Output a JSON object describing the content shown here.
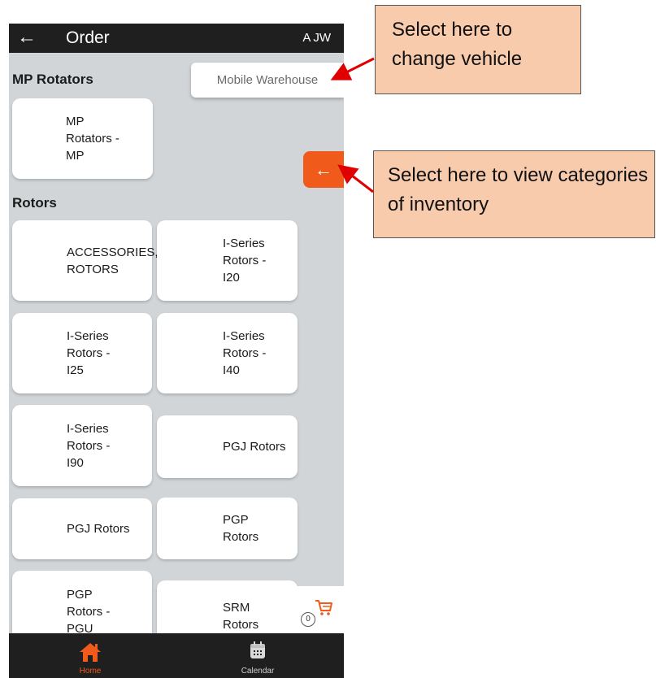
{
  "app": {
    "title": "Order",
    "back_icon": "back-arrow-icon",
    "user_initials": "JW",
    "user_icon": "person-icon"
  },
  "vehicle_selector": {
    "value": "Mobile Warehouse"
  },
  "category_toggle": {
    "icon": "arrow-left-icon"
  },
  "sections": [
    {
      "title": "MP Rotators",
      "cards": [
        {
          "label": "MP Rotators -MP"
        }
      ]
    },
    {
      "title": "Rotors",
      "cards": [
        {
          "label": "ACCESSORIES, ROTORS"
        },
        {
          "label": "I-Series Rotors - I20"
        },
        {
          "label": "I-Series Rotors - I25"
        },
        {
          "label": "I-Series Rotors - I40"
        },
        {
          "label": "I-Series Rotors - I90"
        },
        {
          "label": "PGJ Rotors"
        },
        {
          "label": "PGJ Rotors"
        },
        {
          "label": "PGP Rotors"
        },
        {
          "label": "PGP Rotors - PGU"
        },
        {
          "label": "SRM Rotors"
        }
      ]
    }
  ],
  "cart": {
    "count": "0",
    "icon": "cart-icon"
  },
  "bottom_nav": [
    {
      "label": "Home",
      "icon": "home-icon",
      "active": true
    },
    {
      "label": "Calendar",
      "icon": "calendar-icon",
      "active": false
    }
  ],
  "callouts": {
    "vehicle": "Select here to change vehicle",
    "categories": "Select here to view categories of inventory"
  },
  "colors": {
    "accent": "#f05a1a",
    "callout_bg": "#f8cbad",
    "arrow": "#e00000",
    "topbar": "#1f1f1f",
    "page_bg": "#d1d5d8"
  }
}
